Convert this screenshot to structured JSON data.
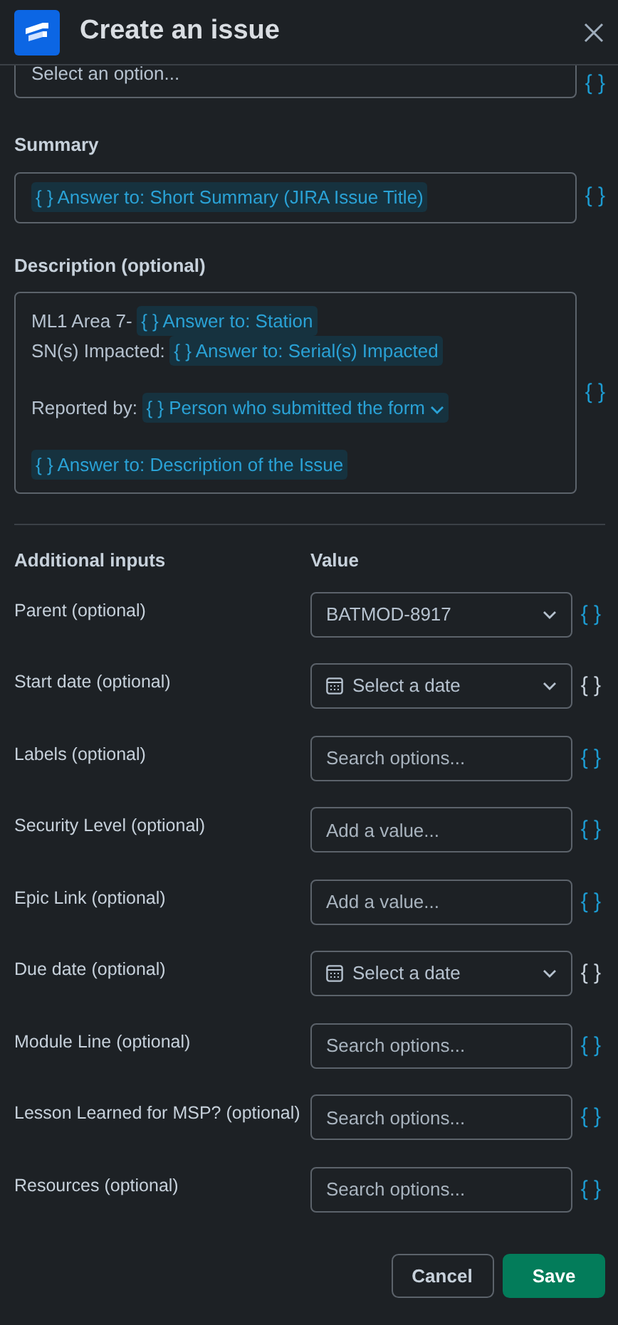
{
  "header": {
    "title": "Create an issue"
  },
  "top_field": {
    "placeholder": "Select an option...",
    "braces": "{ }"
  },
  "summary": {
    "label": "Summary",
    "token": "{ } Answer to: Short Summary (JIRA Issue Title)",
    "braces": "{ }"
  },
  "description": {
    "label": "Description (optional)",
    "braces": "{ }",
    "lines": [
      {
        "kind": "text",
        "segments": [
          {
            "kind": "text",
            "text": "ML1 Area 7-"
          },
          {
            "kind": "token",
            "text": "{ } Answer to: Station",
            "menu": false
          }
        ]
      },
      {
        "kind": "text",
        "segments": [
          {
            "kind": "text",
            "text": "SN(s) Impacted:"
          },
          {
            "kind": "token",
            "text": "{ } Answer to: Serial(s) Impacted",
            "menu": false
          }
        ]
      },
      {
        "kind": "blank"
      },
      {
        "kind": "text",
        "segments": [
          {
            "kind": "text",
            "text": "Reported by:"
          },
          {
            "kind": "token",
            "text": "{ } Person who submitted the form",
            "menu": true
          }
        ]
      },
      {
        "kind": "blank"
      },
      {
        "kind": "text",
        "segments": [
          {
            "kind": "token",
            "text": "{ } Answer to: Description of the Issue",
            "menu": false
          }
        ]
      }
    ]
  },
  "additional": {
    "heading": "Additional inputs",
    "value_heading": "Value",
    "rows": [
      {
        "label": "Parent (optional)",
        "kind": "select",
        "value": "BATMOD-8917",
        "braces": "{ }",
        "highlighted": true
      },
      {
        "label": "Start date (optional)",
        "kind": "date",
        "placeholder": "Select a date",
        "braces": "{ }",
        "highlighted": false
      },
      {
        "label": "Labels (optional)",
        "kind": "search",
        "placeholder": "Search options...",
        "braces": "{ }",
        "highlighted": true
      },
      {
        "label": "Security Level (optional)",
        "kind": "text",
        "placeholder": "Add a value...",
        "braces": "{ }",
        "highlighted": true
      },
      {
        "label": "Epic Link (optional)",
        "kind": "text",
        "placeholder": "Add a value...",
        "braces": "{ }",
        "highlighted": true
      },
      {
        "label": "Due date (optional)",
        "kind": "date",
        "placeholder": "Select a date",
        "braces": "{ }",
        "highlighted": false
      },
      {
        "label": "Module Line (optional)",
        "kind": "search",
        "placeholder": "Search options...",
        "braces": "{ }",
        "highlighted": true
      },
      {
        "label": "Lesson Learned for MSP? (optional)",
        "kind": "search",
        "placeholder": "Search options...",
        "braces": "{ }",
        "highlighted": true
      },
      {
        "label": "Resources (optional)",
        "kind": "search",
        "placeholder": "Search options...",
        "braces": "{ }",
        "highlighted": true
      }
    ]
  },
  "footer": {
    "buttons": [
      {
        "label": "Cancel",
        "kind": "secondary"
      },
      {
        "label": "Save",
        "kind": "primary"
      }
    ]
  }
}
